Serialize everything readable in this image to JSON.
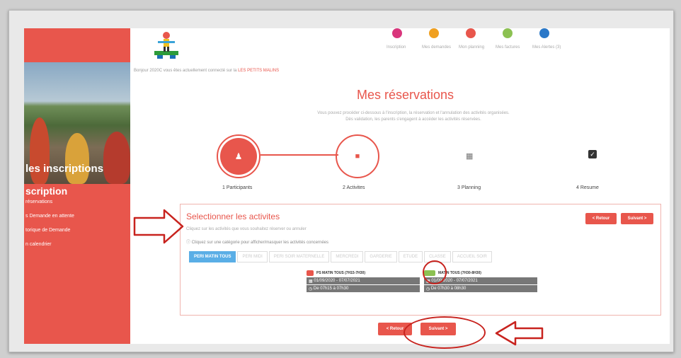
{
  "brand": {
    "accent": "#e8564c",
    "tab_active": "#5aaee6"
  },
  "topbar": {
    "step_captions": [
      "Inscription",
      "Mes demandes",
      "Mon planning",
      "Mes factures",
      "Mes Alertes (3)"
    ]
  },
  "sidebar": {
    "title": "les inscriptions",
    "subtitle": "scription",
    "links": [
      "réservations",
      "s Demande en attente",
      "torique de Demande",
      "n calendrier"
    ]
  },
  "welcome": {
    "text": "Bonjour 2020C vous êtes actuellement connecté sur la",
    "org": "LES PETITS MALINS"
  },
  "page": {
    "title": "Mes réservations",
    "intro_1": "Vous pouvez procéder ci-dessous à l'inscription, la réservation et l'annulation des activités organisées.",
    "intro_2": "Dès validation, les parents s'engagent à accéder les activités réservées."
  },
  "steps": [
    {
      "label": "1 Participants"
    },
    {
      "label": "2 Activites"
    },
    {
      "label": "3 Planning"
    },
    {
      "label": "4 Resume"
    }
  ],
  "panel": {
    "title": "Selectionner les activites",
    "subtitle": "Cliquez sur les activités que vous souhaitez réserver ou annuler",
    "info": "Cliquez sur une catégorie pour afficher/masquer les activités concernées",
    "retour_top": "< Retour",
    "suivant_top": "Suivant >",
    "tabs": [
      "PERI MATIN TOUS",
      "PERI MIDI",
      "PERI SOIR MATERNELLE",
      "MERCREDI",
      "GARDERIE",
      "ETUDE",
      "CLASSE",
      "ACCUEIL SOIR"
    ]
  },
  "cards": [
    {
      "title": "PS MATIN TOUS (7H15-7H30)",
      "dates": "01/09/2020 - 07/07/2021",
      "hours": "De 07h15 à 07h30",
      "toggle": "#e8564c"
    },
    {
      "title": "MATIN TOUS (7H30-8H30)",
      "dates": "01/09/2020 - 07/07/2021",
      "hours": "De 07h30 à 08h30",
      "toggle": "#8cc152"
    }
  ],
  "footer": {
    "retour": "< Retour",
    "suivant": "Suivant >"
  }
}
